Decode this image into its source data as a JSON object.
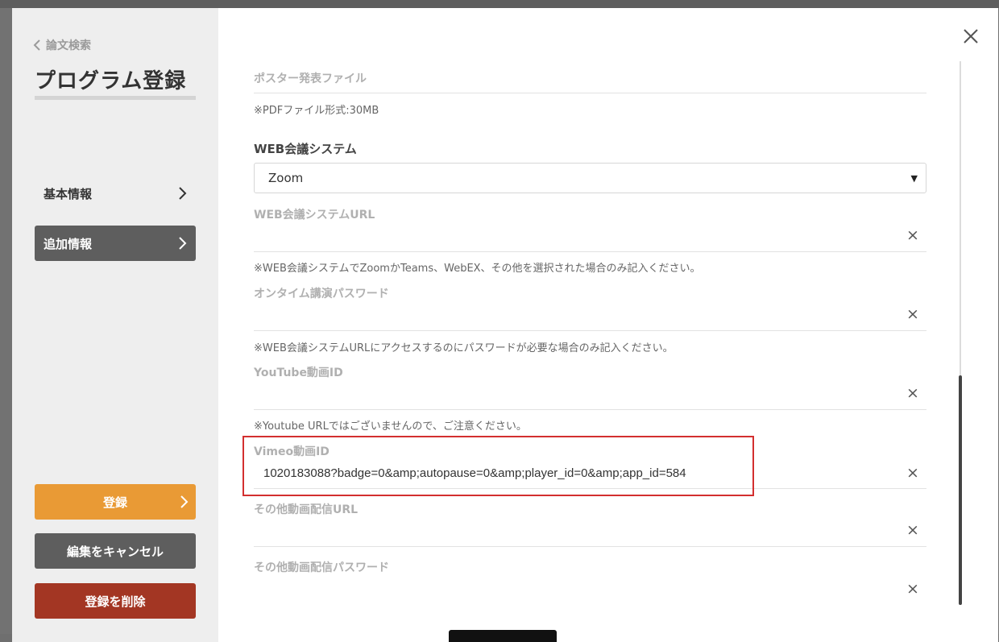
{
  "sidebar": {
    "back_label": "論文検索",
    "title": "プログラム登録",
    "nav": [
      {
        "label": "基本情報"
      },
      {
        "label": "追加情報"
      }
    ]
  },
  "buttons": {
    "register": "登録",
    "cancel": "編集をキャンセル",
    "delete": "登録を削除"
  },
  "form": {
    "poster_label": "ポスター発表ファイル",
    "poster_note": "※PDFファイル形式:30MB",
    "web_system_label": "WEB会議システム",
    "web_system_value": "Zoom",
    "web_url_label": "WEB会議システムURL",
    "web_url_value": "",
    "web_url_note": "※WEB会議システムでZoomかTeams、WebEX、その他を選択された場合のみ記入ください。",
    "ontime_pw_label": "オンタイム講演パスワード",
    "ontime_pw_value": "",
    "ontime_pw_note": "※WEB会議システムURLにアクセスするのにパスワードが必要な場合のみ記入ください。",
    "youtube_label": "YouTube動画ID",
    "youtube_value": "",
    "youtube_note": "※Youtube URLではございませんので、ご注意ください。",
    "vimeo_label": "Vimeo動画ID",
    "vimeo_value": "1020183088?badge=0&amp;autopause=0&amp;player_id=0&amp;app_id=584",
    "other_url_label": "その他動画配信URL",
    "other_url_value": "",
    "other_pw_label": "その他動画配信パスワード",
    "other_pw_value": "",
    "clear_glyph": "×"
  },
  "colors": {
    "accent_orange": "#e99a35",
    "danger_red": "#a33623",
    "nav_active": "#5e5e5e",
    "highlight": "#d32f2f"
  },
  "icons": [
    "chevron-left-icon",
    "chevron-right-icon",
    "close-icon",
    "dropdown-arrow-icon",
    "clear-icon"
  ]
}
